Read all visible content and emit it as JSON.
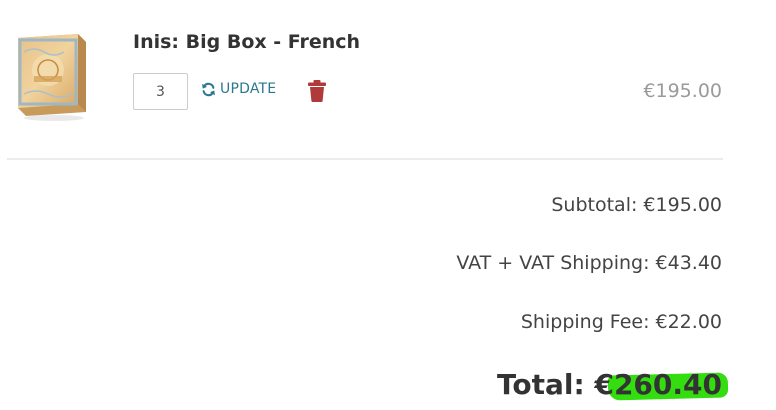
{
  "cart": {
    "item": {
      "title": "Inis: Big Box - French",
      "quantity": "3",
      "update_label": "UPDATE",
      "price": "€195.00",
      "image_icon": "board-game-box-image"
    },
    "summary": {
      "subtotal": "Subtotal: €195.00",
      "vat": "VAT + VAT Shipping: €43.40",
      "shipping_fee": "Shipping Fee: €22.00",
      "total_label": "Total: ",
      "total_value": "€260.40"
    }
  },
  "colors": {
    "accent": "#2a7890",
    "delete": "#b03a3a",
    "highlight": "#33dd10",
    "muted_price": "#9a9a9a"
  }
}
